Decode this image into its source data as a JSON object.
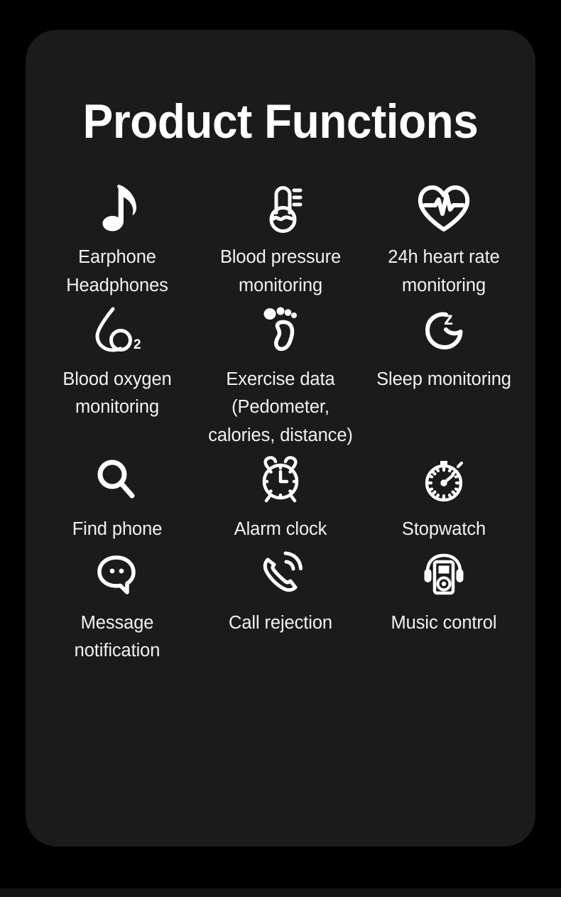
{
  "page": {
    "background_color": "#000000",
    "card_color": "#1b1b1b",
    "text_color": "#f2f2f2"
  },
  "header": {
    "title": "Product Functions"
  },
  "features": [
    {
      "icon": "music-note-icon",
      "label": "Earphone Headphones"
    },
    {
      "icon": "thermometer-icon",
      "label": "Blood pressure monitoring"
    },
    {
      "icon": "heart-pulse-icon",
      "label": "24h heart rate monitoring"
    },
    {
      "icon": "blood-oxygen-drop-icon",
      "label": "Blood oxygen monitoring"
    },
    {
      "icon": "footprint-icon",
      "label": "Exercise data (Pedometer, calories, distance)"
    },
    {
      "icon": "moon-sleep-icon",
      "label": "Sleep monitoring"
    },
    {
      "icon": "magnifier-icon",
      "label": "Find phone"
    },
    {
      "icon": "alarm-clock-icon",
      "label": "Alarm clock"
    },
    {
      "icon": "stopwatch-icon",
      "label": "Stopwatch"
    },
    {
      "icon": "speech-bubble-icon",
      "label": "Message notification"
    },
    {
      "icon": "phone-call-icon",
      "label": "Call rejection"
    },
    {
      "icon": "music-player-headphones-icon",
      "label": "Music control"
    }
  ]
}
